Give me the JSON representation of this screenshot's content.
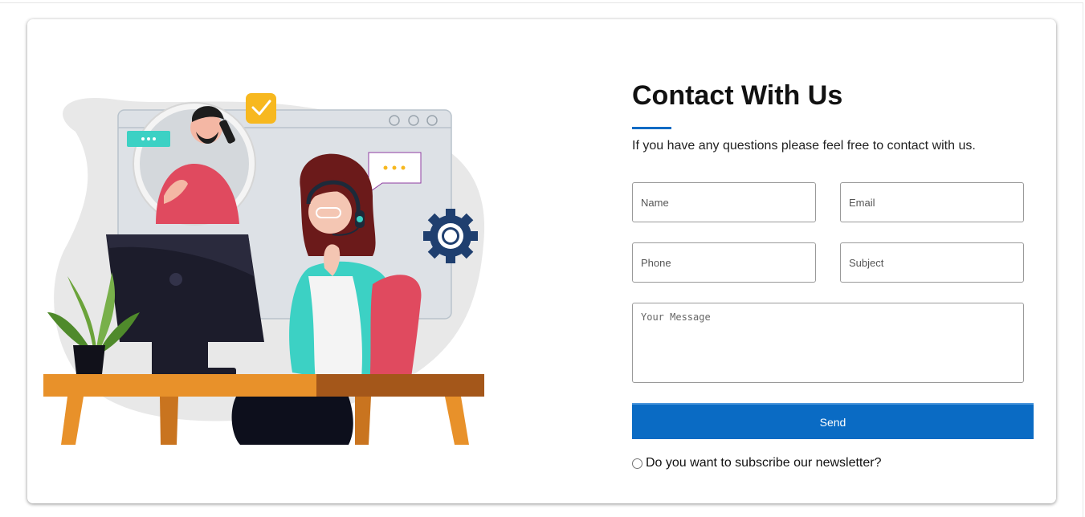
{
  "contact": {
    "title": "Contact With Us",
    "subtitle": "If you have any questions please feel free to contact with us.",
    "fields": {
      "name_placeholder": "Name",
      "email_placeholder": "Email",
      "phone_placeholder": "Phone",
      "subject_placeholder": "Subject",
      "message_placeholder": "Your Message"
    },
    "send_label": "Send",
    "newsletter_label": "Do you want to subscribe our newsletter?",
    "accent_color": "#0a6bc4"
  },
  "illustration": {
    "icons": [
      "chat-dots-icon",
      "checkmark-badge-icon",
      "gear-icon",
      "headset-icon",
      "phone-icon",
      "monitor-icon",
      "plant-icon"
    ]
  }
}
